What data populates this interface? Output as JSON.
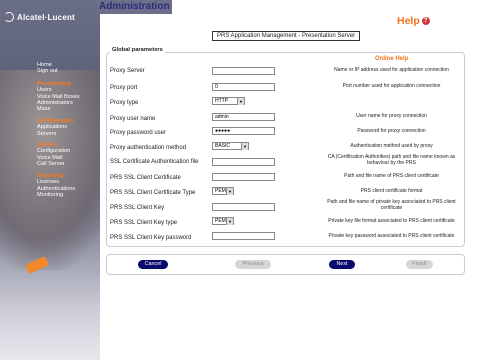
{
  "brand": {
    "logo_text": "Alcatel·Lucent"
  },
  "header": {
    "title": "Administration",
    "help_label": "Help",
    "page_caption": "PRS Application Management - Presentation Server"
  },
  "sidebar": {
    "groups": [
      {
        "items": [
          {
            "label": "Home"
          },
          {
            "label": "Sign out"
          }
        ]
      },
      {
        "title": "Provisioning",
        "items": [
          {
            "label": "Users"
          },
          {
            "label": "Voice Mail Boxes"
          },
          {
            "label": "Administrators"
          },
          {
            "label": "Mass"
          }
        ]
      },
      {
        "title": "Configuration",
        "items": [
          {
            "label": "Applications"
          },
          {
            "label": "Servers"
          }
        ]
      },
      {
        "title": "System",
        "items": [
          {
            "label": "Configuration"
          },
          {
            "label": "Voice Mail"
          },
          {
            "label": "Call Server"
          }
        ]
      },
      {
        "title": "Reporting",
        "items": [
          {
            "label": "Licenses"
          },
          {
            "label": "Authentications"
          },
          {
            "label": "Monitoring"
          }
        ]
      }
    ]
  },
  "form": {
    "section_title": "Global parameters",
    "online_help_title": "Online Help",
    "fields": [
      {
        "label": "Proxy Server",
        "type": "text",
        "value": "",
        "help": "Name or IP address used for application connection"
      },
      {
        "label": "Proxy port",
        "type": "text",
        "value": "0",
        "help": "Port number used for application connection"
      },
      {
        "label": "Proxy type",
        "type": "select",
        "value": "HTTP",
        "help": ""
      },
      {
        "label": "Proxy user name",
        "type": "text",
        "value": "admin",
        "help": "User name for proxy connection"
      },
      {
        "label": "Proxy password user",
        "type": "password",
        "value": "●●●●●",
        "help": "Password for proxy connection"
      },
      {
        "label": "Proxy authentication method",
        "type": "select",
        "value": "BASIC",
        "help": "Authentication method used by proxy"
      },
      {
        "label": "SSL Certificate Authentication file",
        "type": "text",
        "value": "",
        "help": "CA (Certification Authorities) path and file name known as behaviour by the PRS"
      },
      {
        "label": "PRS SSL Client Certificate",
        "type": "text",
        "value": "",
        "help": "Path and file name of PRS client certificate"
      },
      {
        "label": "PRS SSL Client Certificate Type",
        "type": "select",
        "value": "PEM",
        "help": "PRS client certificate format"
      },
      {
        "label": "PRS SSL Client Key",
        "type": "text",
        "value": "",
        "help": "Path and file name of private key associated to PRS client certificate"
      },
      {
        "label": "PRS SSL Client Key type",
        "type": "select",
        "value": "PEM",
        "help": "Private key file format associated to PRS client certificate"
      },
      {
        "label": "PRS SSL Client Key password",
        "type": "text",
        "value": "",
        "help": "Private key password associated to PRS client certificate"
      }
    ]
  },
  "buttons": {
    "cancel": "Cancel",
    "previous": "Previous",
    "next": "Next",
    "finish": "Finish"
  },
  "colors": {
    "accent": "#f0731d",
    "nav_button": "#0a0a6e",
    "title": "#2a2e78"
  }
}
